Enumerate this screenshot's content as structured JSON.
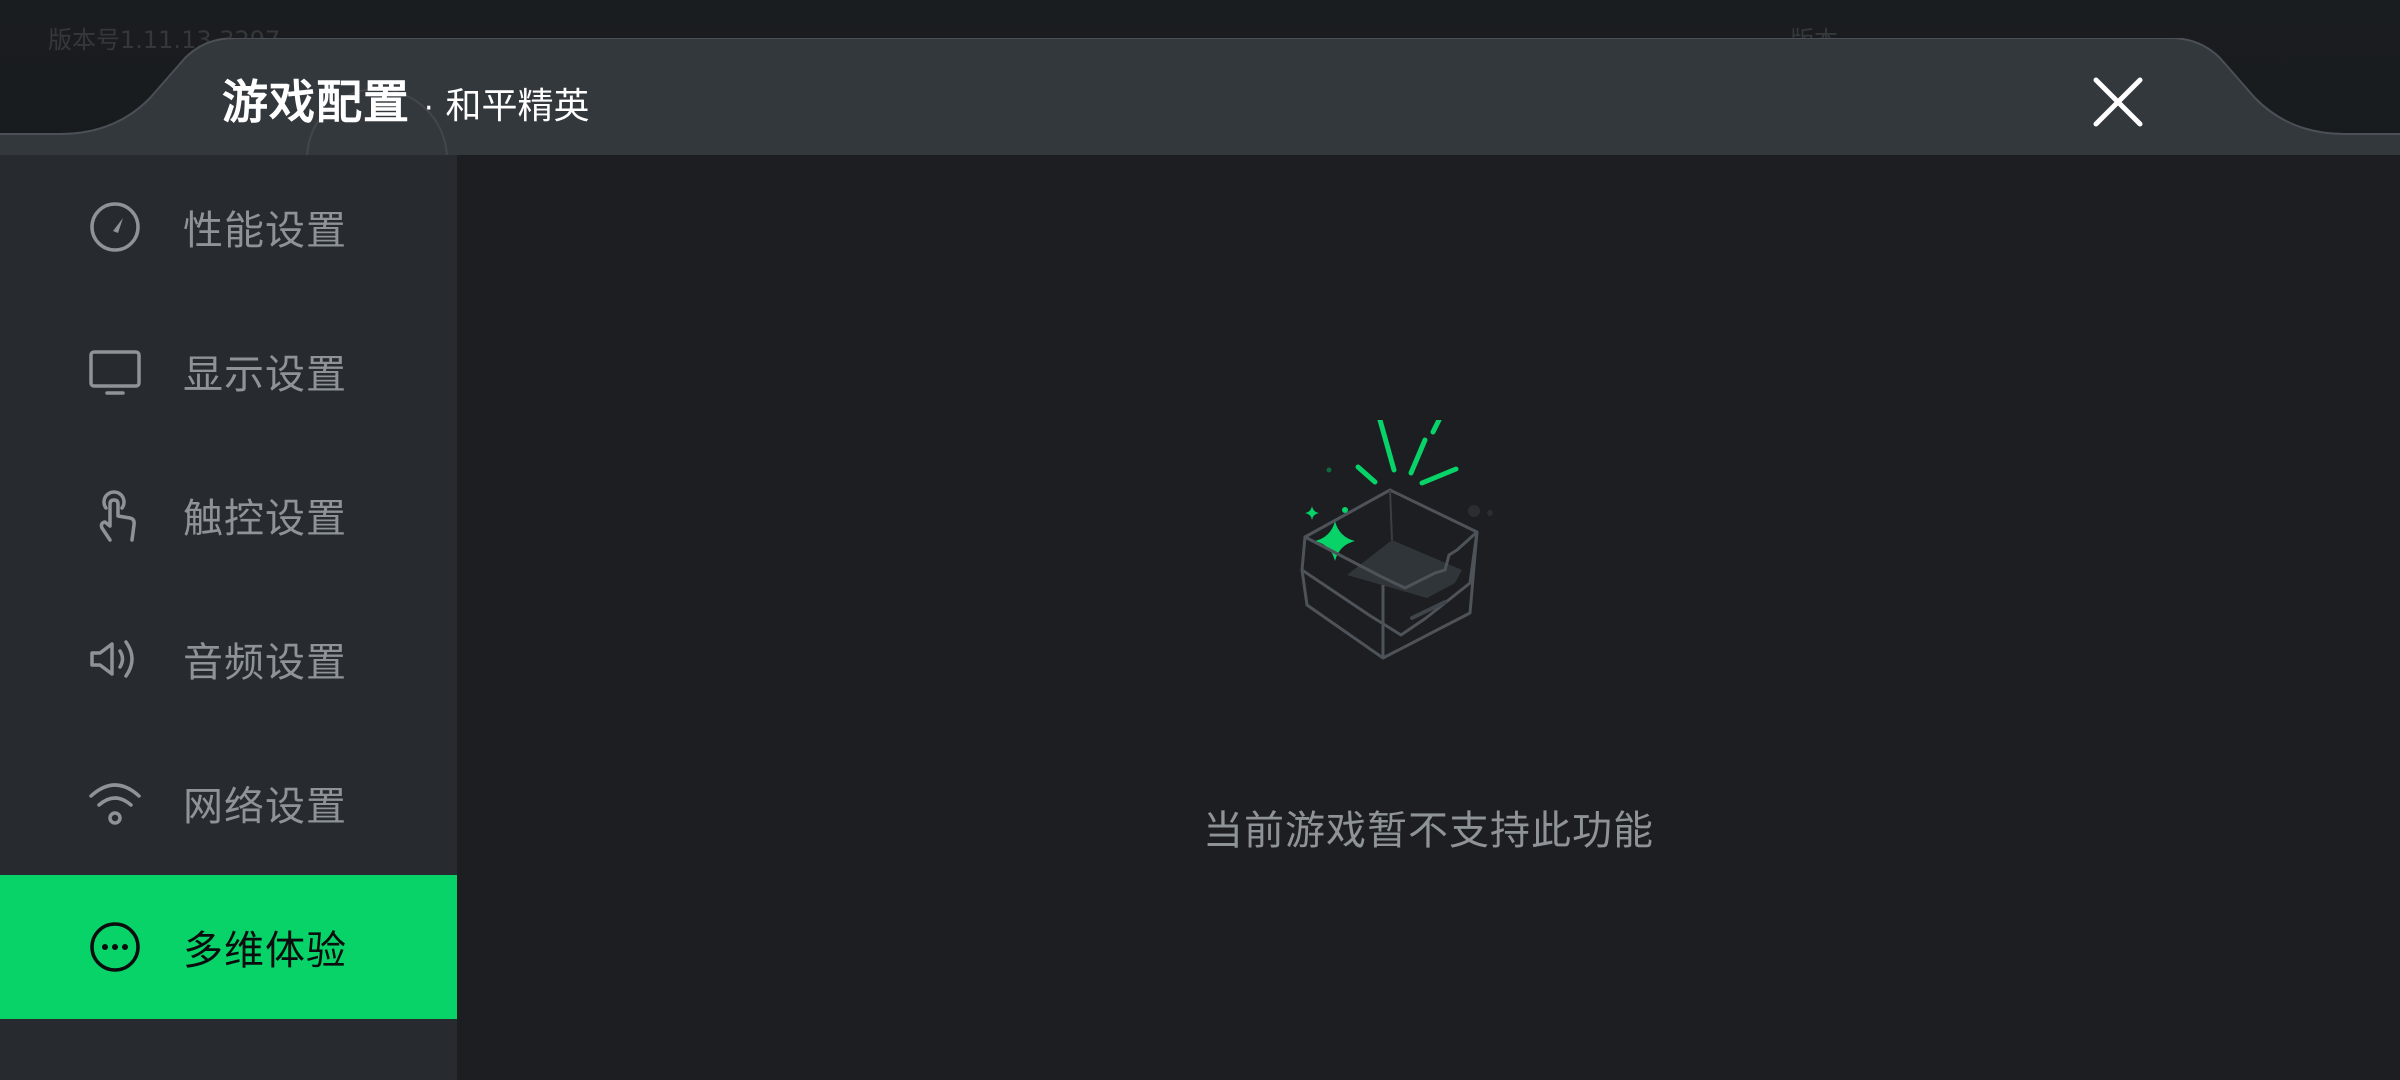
{
  "background": {
    "top_left_text": "版本号1.11.13.3297",
    "top_right_text": "版本…"
  },
  "header": {
    "title": "游戏配置",
    "separator": "·",
    "game_name": "和平精英"
  },
  "sidebar": {
    "items": [
      {
        "label": "性能设置",
        "icon": "speedometer-icon",
        "active": false
      },
      {
        "label": "显示设置",
        "icon": "monitor-icon",
        "active": false
      },
      {
        "label": "触控设置",
        "icon": "touch-icon",
        "active": false
      },
      {
        "label": "音频设置",
        "icon": "speaker-icon",
        "active": false
      },
      {
        "label": "网络设置",
        "icon": "wifi-icon",
        "active": false
      },
      {
        "label": "多维体验",
        "icon": "more-icon",
        "active": true
      }
    ]
  },
  "content": {
    "empty_message": "当前游戏暂不支持此功能"
  },
  "colors": {
    "accent": "#07d369",
    "sidebar_bg": "#272b2f",
    "content_bg": "#1c1e21",
    "header_bg": "#33383d",
    "muted_text": "#8e9398"
  }
}
